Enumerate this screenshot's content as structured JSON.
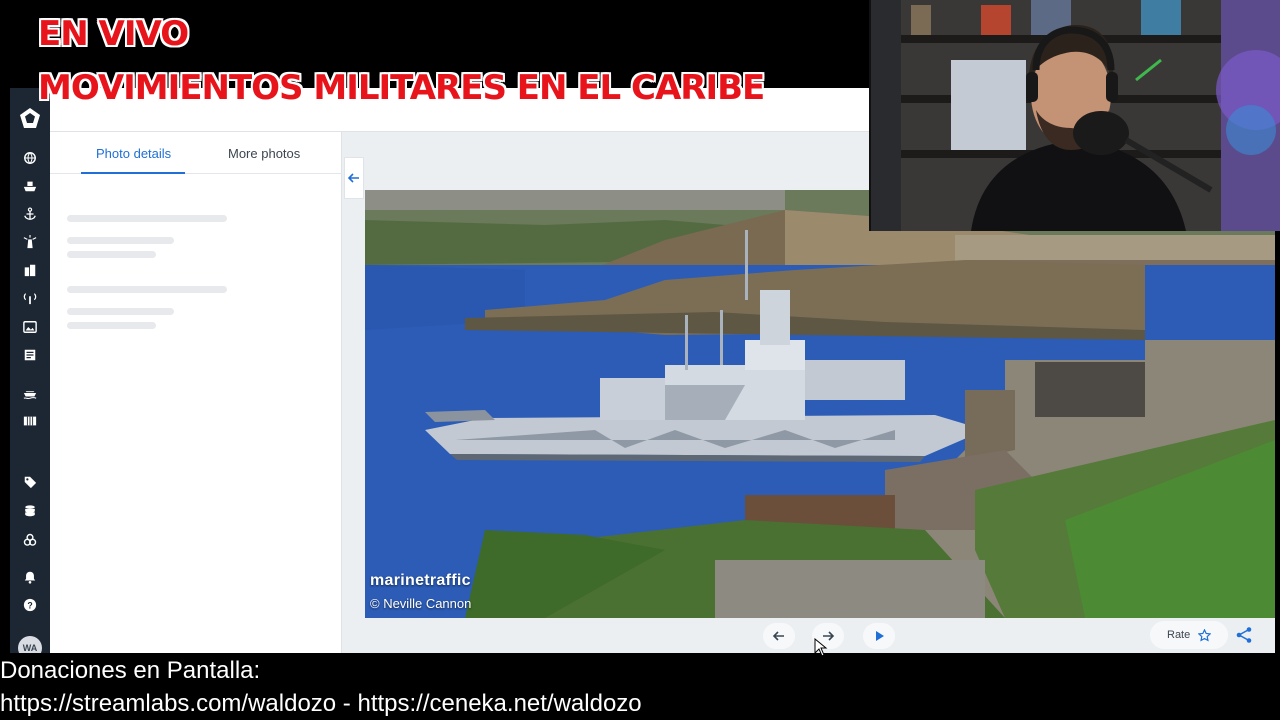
{
  "stream": {
    "title_line1": "EN VIVO",
    "title_line2": "MOVIMIENTOS MILITARES EN EL CARIBE",
    "donations_label": "Donaciones en Pantalla:",
    "donation_links": "https://streamlabs.com/waldozo - https://ceneka.net/waldozo"
  },
  "app": {
    "avatar_initials": "WA",
    "sidebar_icons": [
      "globe-icon",
      "ship-icon",
      "anchor-icon",
      "lighthouse-icon",
      "buildings-icon",
      "antenna-icon",
      "photos-icon",
      "news-icon",
      "fleet-icon",
      "table-icon",
      "tag-icon",
      "database-icon",
      "layers-icon",
      "bell-icon",
      "help-icon"
    ],
    "tabs": [
      {
        "label": "Photo details",
        "active": true
      },
      {
        "label": "More photos",
        "active": false
      }
    ],
    "photo": {
      "brand": "marinetraffic",
      "credit": "© Neville Cannon"
    },
    "controls": {
      "rate_label": "Rate"
    },
    "colors": {
      "accent": "#1f6fd6",
      "sidebar": "#1c2733",
      "title_red": "#e8141b"
    }
  }
}
